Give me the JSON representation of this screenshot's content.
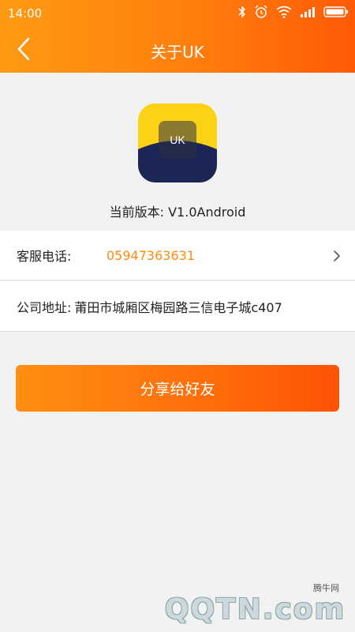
{
  "status_bar": {
    "time": "14:00",
    "icons": [
      "bluetooth-icon",
      "alarm-icon",
      "wifi-icon",
      "signal-icon",
      "battery-icon"
    ]
  },
  "header": {
    "title": "关于UK",
    "back_icon": "back-arrow-icon"
  },
  "app": {
    "icon_text": "UK",
    "version_label": "当前版本: V1.0Android"
  },
  "contact": {
    "phone_label": "客服电话:",
    "phone_value": "05947363631",
    "address_label": "公司地址:",
    "address_value": "莆田市城厢区梅园路三信电子城c407"
  },
  "actions": {
    "share_label": "分享给好友"
  },
  "watermark": {
    "small_text": "腾牛网",
    "logo_text": "QQTN.com"
  },
  "colors": {
    "accent": "#ff7e0d",
    "phone_text": "#ff8a0f",
    "background": "#f2f2f2"
  }
}
